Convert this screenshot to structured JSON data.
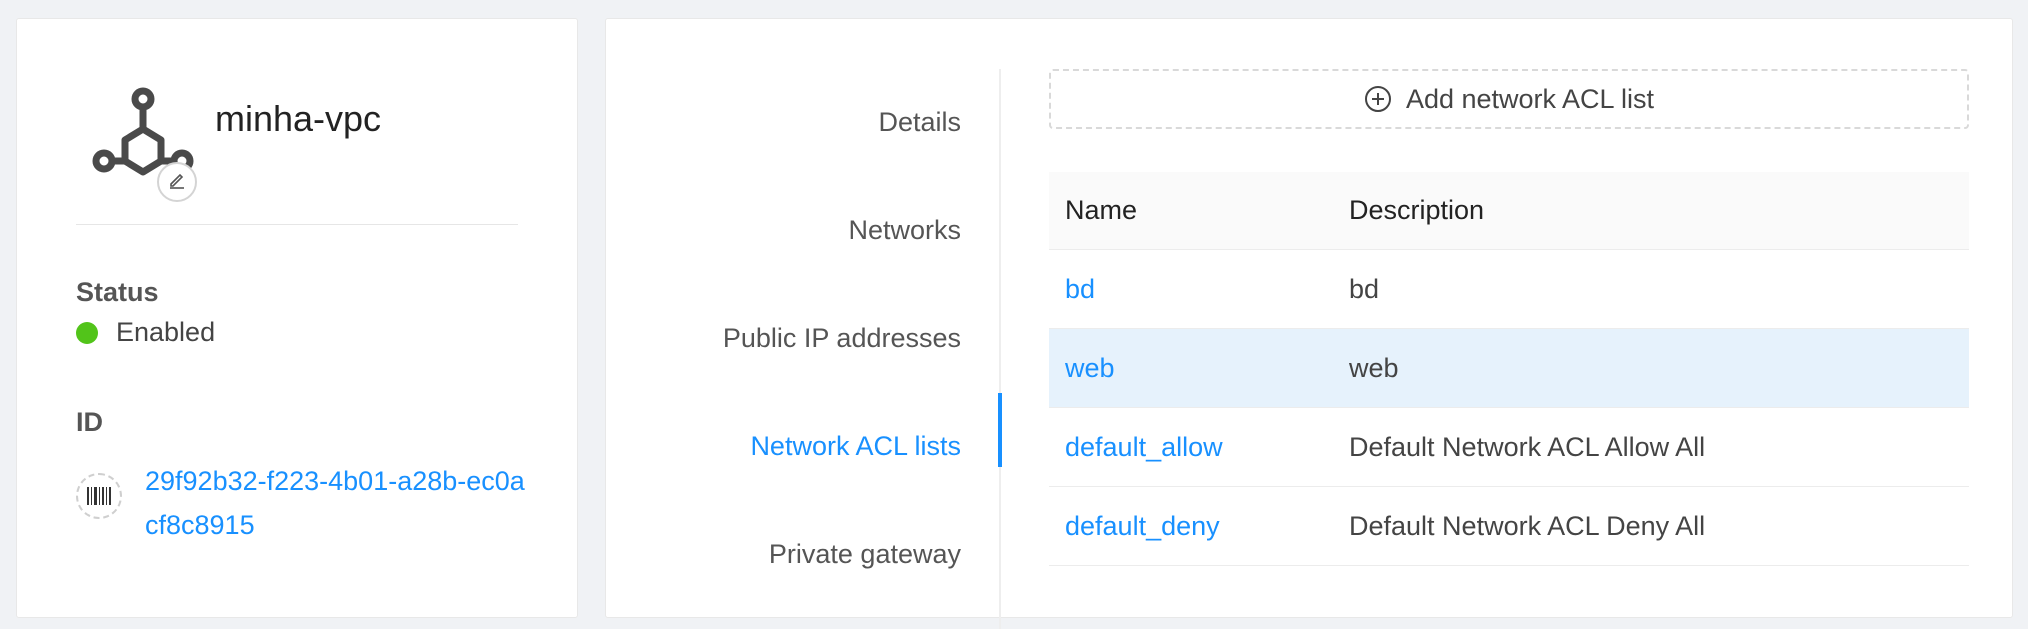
{
  "vpc": {
    "name": "minha-vpc",
    "icon": "vpc-network-icon"
  },
  "status": {
    "label": "Status",
    "value": "Enabled",
    "color": "#52c41a"
  },
  "id": {
    "label": "ID",
    "value": "29f92b32-f223-4b01-a28b-ec0acf8c8915",
    "icon": "barcode-icon"
  },
  "tabs": [
    {
      "label": "Details",
      "active": false
    },
    {
      "label": "Networks",
      "active": false
    },
    {
      "label": "Public IP addresses",
      "active": false
    },
    {
      "label": "Network ACL lists",
      "active": true
    },
    {
      "label": "Private gateway",
      "active": false
    }
  ],
  "add_button": {
    "label": "Add network ACL list",
    "icon": "plus-circle-icon"
  },
  "table": {
    "columns": [
      "Name",
      "Description"
    ],
    "rows": [
      {
        "name": "bd",
        "description": "bd"
      },
      {
        "name": "web",
        "description": "web"
      },
      {
        "name": "default_allow",
        "description": "Default Network ACL Allow All"
      },
      {
        "name": "default_deny",
        "description": "Default Network ACL Deny All"
      }
    ]
  },
  "colors": {
    "accent": "#1890ff",
    "selected_row": "#e6f2fc"
  }
}
